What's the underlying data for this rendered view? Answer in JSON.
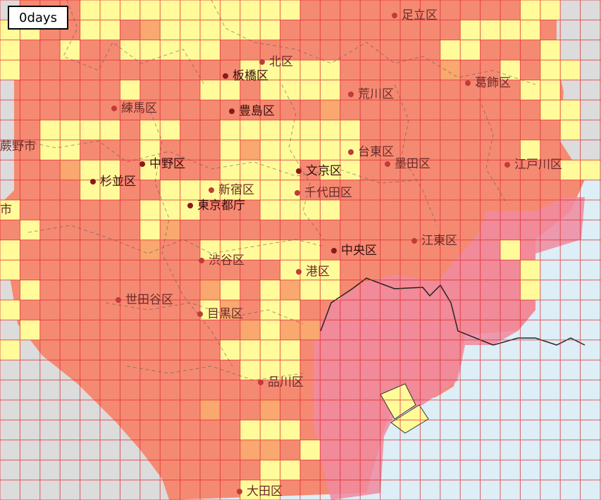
{
  "time_label": "0days",
  "colors": {
    "land_gray": "#dcdcdc",
    "sea": "#ddeef6",
    "risk_high": "#f58a72",
    "risk_mid": "#f9a86f",
    "risk_low": "#fffb9a",
    "bay_shade": "#f08aa0",
    "grid_line": "#e0282f"
  },
  "wards": [
    {
      "name": "足立区",
      "dark": false
    },
    {
      "name": "北区",
      "dark": false
    },
    {
      "name": "板橋区",
      "dark": true
    },
    {
      "name": "荒川区",
      "dark": false
    },
    {
      "name": "葛飾区",
      "dark": false
    },
    {
      "name": "練馬区",
      "dark": false
    },
    {
      "name": "豊島区",
      "dark": true
    },
    {
      "name": "中野区",
      "dark": true
    },
    {
      "name": "台東区",
      "dark": false
    },
    {
      "name": "文京区",
      "dark": true
    },
    {
      "name": "墨田区",
      "dark": false
    },
    {
      "name": "江戸川区",
      "dark": false
    },
    {
      "name": "杉並区",
      "dark": true
    },
    {
      "name": "新宿区",
      "dark": false
    },
    {
      "name": "千代田区",
      "dark": false
    },
    {
      "name": "東京都庁",
      "dark": true
    },
    {
      "name": "中央区",
      "dark": true
    },
    {
      "name": "江東区",
      "dark": false
    },
    {
      "name": "渋谷区",
      "dark": false
    },
    {
      "name": "港区",
      "dark": false
    },
    {
      "name": "世田谷区",
      "dark": false
    },
    {
      "name": "目黒区",
      "dark": false
    },
    {
      "name": "品川区",
      "dark": false
    },
    {
      "name": "大田区",
      "dark": false
    },
    {
      "name": "蕨野市",
      "dark": false
    },
    {
      "name": "市",
      "dark": false
    }
  ]
}
